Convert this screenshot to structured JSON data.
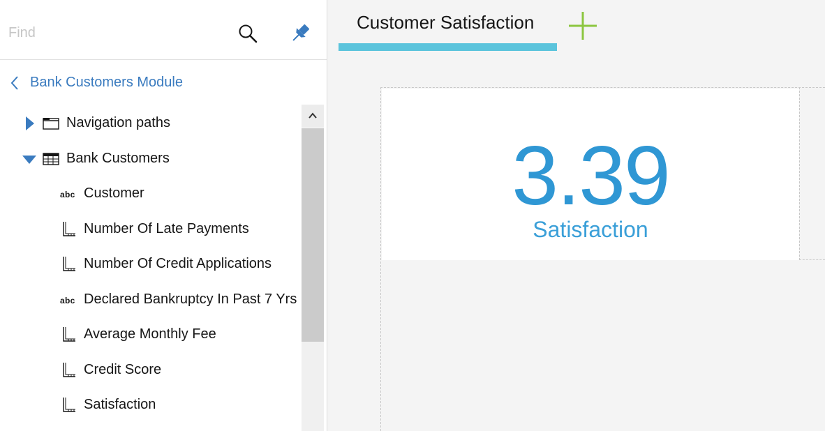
{
  "search": {
    "placeholder": "Find"
  },
  "module": {
    "title": "Bank Customers Module"
  },
  "tree": {
    "items": [
      {
        "label": "Navigation paths",
        "type": "folder",
        "expanded": false
      },
      {
        "label": "Bank Customers",
        "type": "table",
        "expanded": true
      },
      {
        "label": "Customer",
        "type": "attribute"
      },
      {
        "label": "Number Of Late Payments",
        "type": "measure"
      },
      {
        "label": "Number Of Credit Applications",
        "type": "measure"
      },
      {
        "label": "Declared Bankruptcy In Past 7 Yrs",
        "type": "attribute"
      },
      {
        "label": "Average Monthly Fee",
        "type": "measure"
      },
      {
        "label": "Credit Score",
        "type": "measure"
      },
      {
        "label": "Satisfaction",
        "type": "measure"
      }
    ],
    "abc_badge": "abc"
  },
  "tabs": [
    {
      "label": "Customer Satisfaction",
      "active": true
    }
  ],
  "kpi": {
    "value": "3.39",
    "label": "Satisfaction"
  },
  "colors": {
    "accent": "#5bc4dc",
    "kpi_blue": "#2f97d4",
    "link_blue": "#3a7bbf",
    "add_green": "#8cc63f",
    "tree_triangle": "#3a7bbf"
  },
  "icons": {
    "search": "search-icon",
    "pin": "pin-icon",
    "back": "chevron-left-icon",
    "add": "plus-icon"
  }
}
